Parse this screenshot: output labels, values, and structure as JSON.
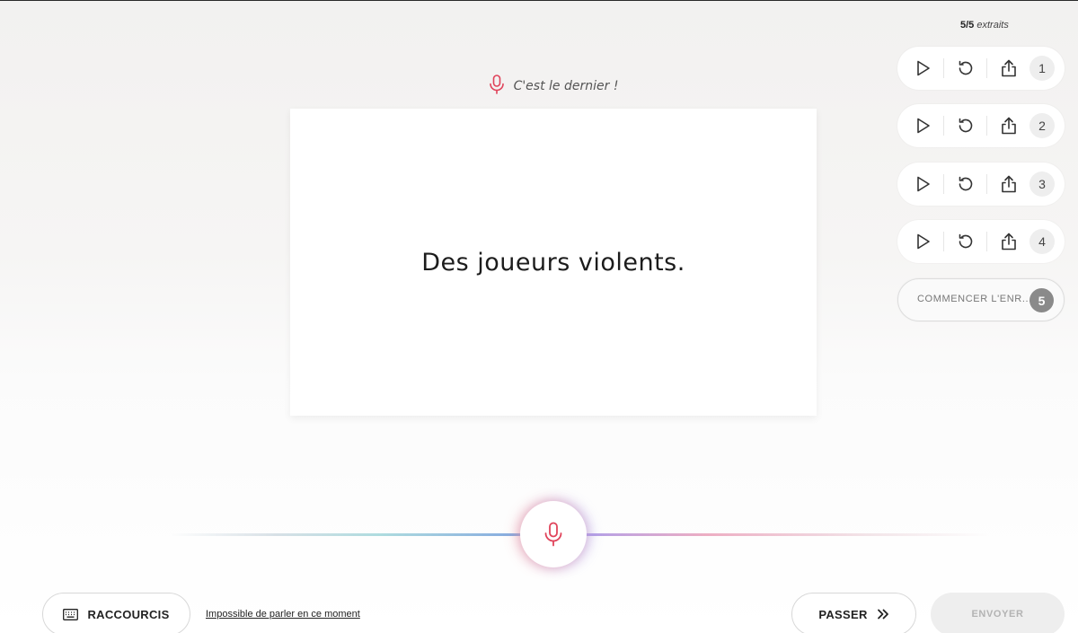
{
  "prompt": {
    "label": "C'est le dernier !",
    "icon": "microphone-icon",
    "icon_color": "#e0435a"
  },
  "card": {
    "sentence": "Des joueurs violents."
  },
  "progress": {
    "count": "5/5",
    "unit": "extraits"
  },
  "recordings": [
    {
      "number": "1"
    },
    {
      "number": "2"
    },
    {
      "number": "3"
    },
    {
      "number": "4"
    }
  ],
  "next_recording": {
    "label": "COMMENCER L'ENR...",
    "number": "5"
  },
  "bottom": {
    "shortcuts_label": "RACCOURCIS",
    "cannot_speak_label": "Impossible de parler en ce moment",
    "skip_label": "PASSER",
    "send_label": "ENVOYER"
  },
  "colors": {
    "accent": "#e0435a",
    "disabled_bg": "#eeeeee",
    "disabled_text": "#b3b3b3"
  }
}
